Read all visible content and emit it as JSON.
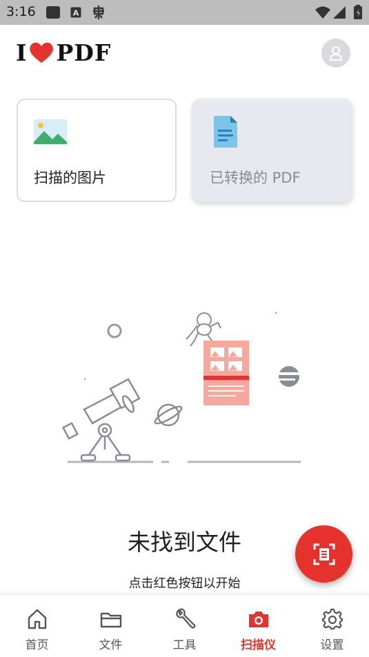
{
  "status_bar": {
    "time": "3:16"
  },
  "header": {
    "logo_text_left": "I",
    "logo_text_right": "PDF",
    "logo_heart_color": "#e5322d"
  },
  "cards": {
    "scanned_images": {
      "label": "扫描的图片",
      "icon": "image-icon"
    },
    "converted_pdf": {
      "label": "已转换的 PDF",
      "icon": "document-icon"
    }
  },
  "empty_state": {
    "title": "未找到文件",
    "subtitle": "点击红色按钮以开始"
  },
  "fab": {
    "icon": "scan-document-icon",
    "color": "#e5322d"
  },
  "bottom_nav": {
    "items": [
      {
        "label": "首页",
        "icon": "home-icon"
      },
      {
        "label": "文件",
        "icon": "folder-icon"
      },
      {
        "label": "工具",
        "icon": "wrench-icon"
      },
      {
        "label": "扫描仪",
        "icon": "camera-icon",
        "active": true
      },
      {
        "label": "设置",
        "icon": "gear-icon"
      }
    ],
    "active_color": "#e5322d"
  }
}
